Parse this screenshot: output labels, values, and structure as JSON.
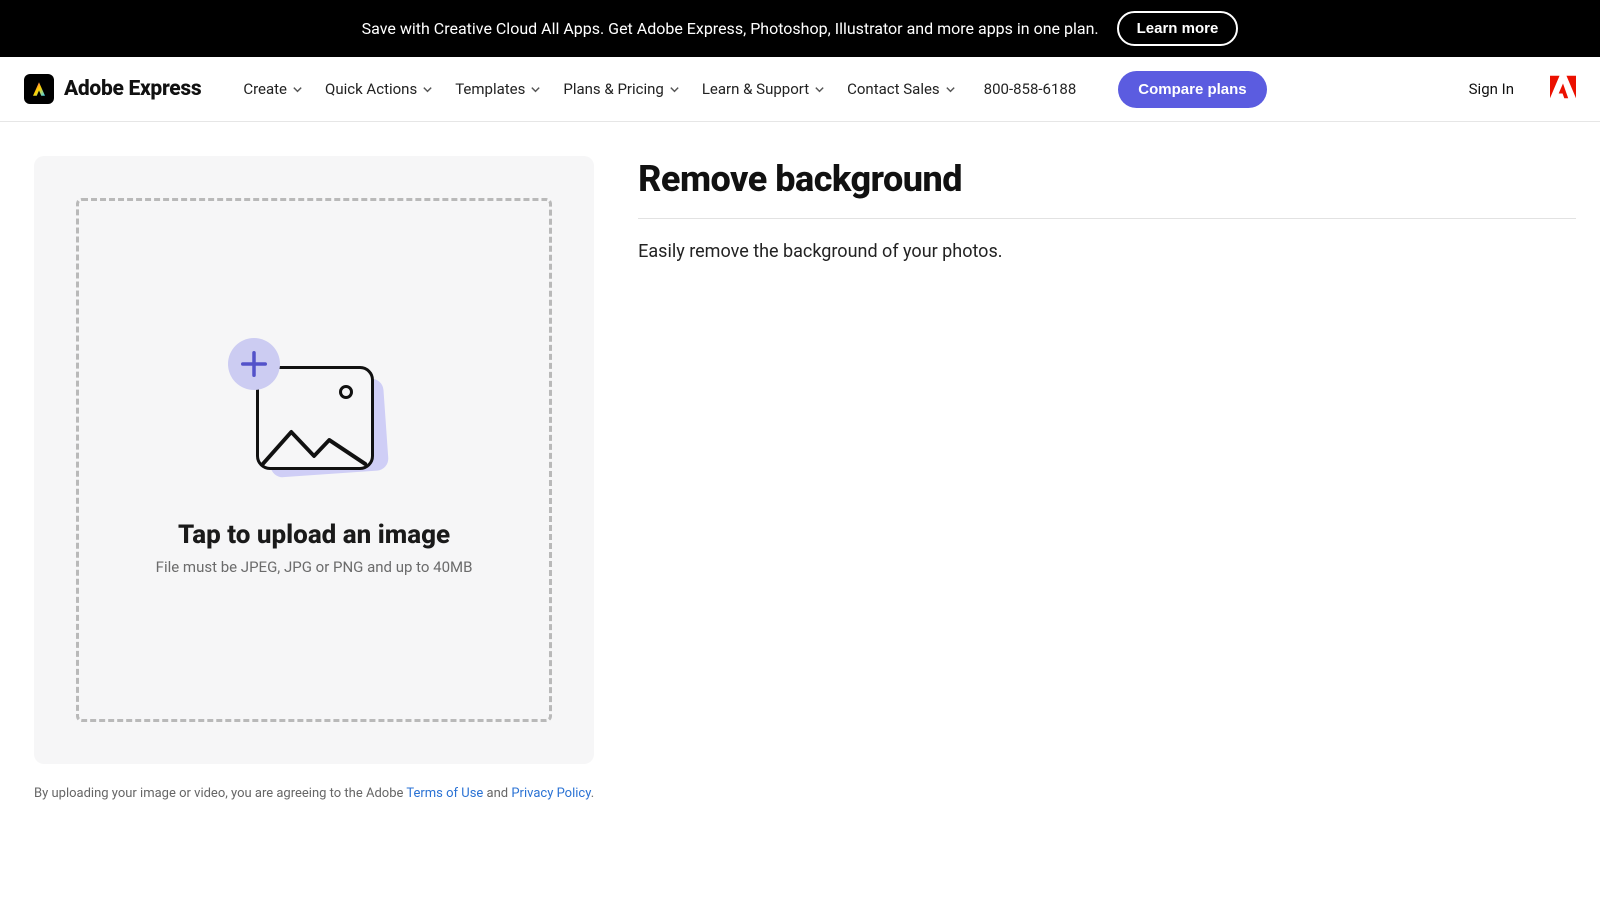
{
  "promo": {
    "message": "Save with Creative Cloud All Apps. Get Adobe Express, Photoshop, Illustrator and more apps in one plan.",
    "cta": "Learn more"
  },
  "header": {
    "brand": "Adobe Express",
    "nav": {
      "create": "Create",
      "quick_actions": "Quick Actions",
      "templates": "Templates",
      "plans": "Plans & Pricing",
      "learn": "Learn & Support",
      "contact": "Contact Sales"
    },
    "phone": "800-858-6188",
    "compare": "Compare plans",
    "sign_in": "Sign In"
  },
  "upload": {
    "headline": "Tap to upload an image",
    "sub": "File must be JPEG, JPG or PNG and up to 40MB"
  },
  "disclaimer": {
    "prefix": "By uploading your image or video, you are agreeing to the Adobe ",
    "terms": "Terms of Use",
    "and": " and ",
    "privacy": "Privacy Policy",
    "suffix": "."
  },
  "side": {
    "title": "Remove background",
    "desc": "Easily remove the background of your photos."
  }
}
